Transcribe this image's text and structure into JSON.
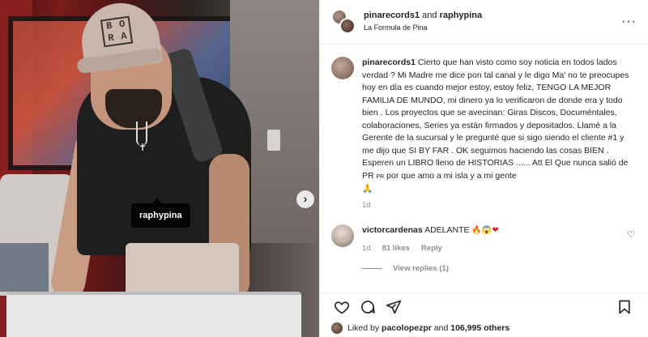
{
  "photo": {
    "tag": "raphypina",
    "cap_logo": [
      "B",
      "O",
      "R",
      "A"
    ],
    "next_icon": "chevron-right-icon"
  },
  "header": {
    "user1": "pinarecords1",
    "conj": "and",
    "user2": "raphypina",
    "subtitle": "La Formula de Pina",
    "more_icon": "more-horizontal-icon"
  },
  "caption": {
    "author": "pinarecords1",
    "text": "Cierto que han visto como soy noticia en todos lados verdad ? Mi Madre me dice pon tal canal y le digo Ma' no te preocupes hoy en día es cuando mejor estoy, estoy feliz, TENGO LA MEJOR FAMILIA DE MUNDO, mi dinero ya lo verificaron de donde era y todo bien . Los proyectos que se avecinan: Giras Discos, Documéntales, colaboraciones, Series ya están firmados y depositados. Llamé a la Gerente de la sucursal y le pregunté que si sigo siendo el cliente #1 y me dijo que SI BY FAR . OK seguimos haciendo las cosas BIEN . Esperen un LIBRO lleno de HISTORIAS ...... Att El Que nunca salió de PR ",
    "pr_small": "PR",
    "text_end": " por que amo a mi isla y a mi gente",
    "emoji": "🙏",
    "time": "1d"
  },
  "comment": {
    "author": "victorcardenas",
    "text": "ADELANTE",
    "emojis": "🔥😱",
    "heart": "❤",
    "time": "1d",
    "likes": "81 likes",
    "reply": "Reply",
    "view_replies": "View replies (1)",
    "like_icon": "heart-outline-icon"
  },
  "actions": {
    "like_icon": "heart-icon",
    "comment_icon": "comment-icon",
    "share_icon": "send-icon",
    "save_icon": "bookmark-icon"
  },
  "likes": {
    "prefix": "Liked by",
    "user": "pacolopezpr",
    "and": "and",
    "count": "106,995 others"
  }
}
